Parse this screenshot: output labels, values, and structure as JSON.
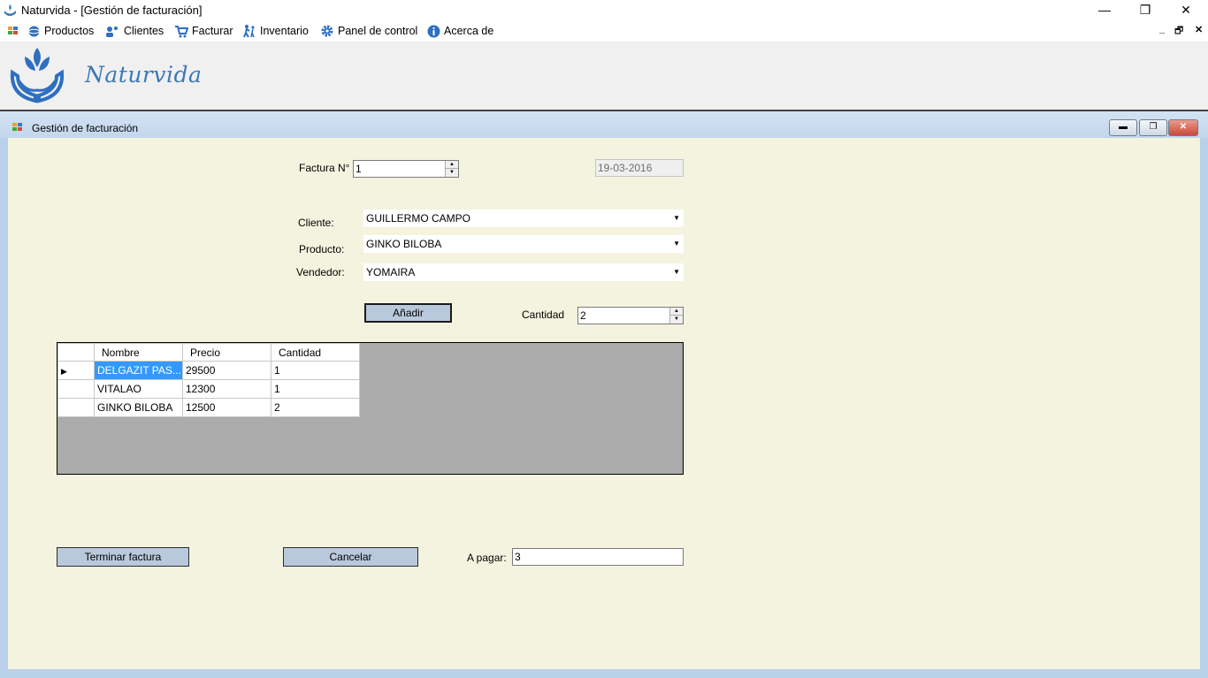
{
  "window": {
    "title": "Naturvida - [Gestión de facturación]",
    "minimize": "—",
    "maximize": "❐",
    "close": "✕"
  },
  "menu": {
    "items": [
      {
        "label": "Productos",
        "icon": "globe-icon"
      },
      {
        "label": "Clientes",
        "icon": "users-icon"
      },
      {
        "label": "Facturar",
        "icon": "cart-icon"
      },
      {
        "label": "Inventario",
        "icon": "people-walking-icon"
      },
      {
        "label": "Panel de control",
        "icon": "gear-icon"
      },
      {
        "label": "Acerca de",
        "icon": "info-icon"
      }
    ],
    "mdi_min": "_",
    "mdi_restore": "🗗",
    "mdi_close": "✕"
  },
  "brand": {
    "name": "Naturvida"
  },
  "child_window": {
    "title": "Gestión de facturación"
  },
  "form": {
    "factura_label": "Factura N°",
    "factura_value": "1",
    "fecha": "19-03-2016",
    "cliente_label": "Cliente:",
    "cliente_value": "GUILLERMO CAMPO",
    "producto_label": "Producto:",
    "producto_value": "GINKO BILOBA",
    "vendedor_label": "Vendedor:",
    "vendedor_value": "YOMAIRA",
    "anadir_button": "Añadir",
    "cantidad_label": "Cantidad",
    "cantidad_value": "2",
    "terminar_button": "Terminar factura",
    "cancelar_button": "Cancelar",
    "apagar_label": "A pagar:",
    "apagar_value": "3"
  },
  "grid": {
    "columns": [
      "Nombre",
      "Precio",
      "Cantidad"
    ],
    "rows": [
      [
        "DELGAZIT PAS...",
        "29500",
        "1"
      ],
      [
        "VITALAO",
        "12300",
        "1"
      ],
      [
        "GINKO BILOBA",
        "12500",
        "2"
      ]
    ]
  },
  "colors": {
    "accent": "#3399ff",
    "client_bg": "#f4f3df",
    "button_bg": "#b9c9dc",
    "brand": "#3a78b8"
  }
}
